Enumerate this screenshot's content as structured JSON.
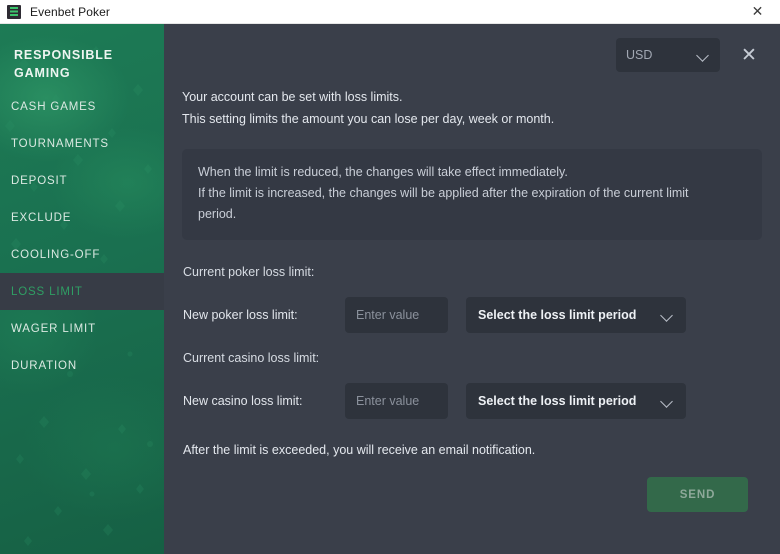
{
  "window": {
    "title": "Evenbet Poker",
    "app_icon": "evenbet-logo-icon",
    "close_label": "✕"
  },
  "sidebar": {
    "header": "RESPONSIBLE GAMING",
    "items": [
      {
        "label": "CASH GAMES",
        "active": false
      },
      {
        "label": "TOURNAMENTS",
        "active": false
      },
      {
        "label": "DEPOSIT",
        "active": false
      },
      {
        "label": "EXCLUDE",
        "active": false
      },
      {
        "label": "COOLING-OFF",
        "active": false
      },
      {
        "label": "LOSS LIMIT",
        "active": true
      },
      {
        "label": "WAGER LIMIT",
        "active": false
      },
      {
        "label": "DURATION",
        "active": false
      }
    ]
  },
  "panel": {
    "currency": {
      "value": "USD",
      "chevron": "chevron-down-icon"
    },
    "close_label": "✕"
  },
  "intro": {
    "line1": "Your account can be set with loss limits.",
    "line2": "This setting limits the amount you can lose per day, week or month."
  },
  "info_box": {
    "line1": "When the limit is reduced, the changes will take effect immediately.",
    "line2": "If the limit is increased, the changes will be applied after the expiration of the current limit",
    "line3": "period."
  },
  "form": {
    "poker": {
      "current_label": "Current poker loss limit:",
      "current_value": "",
      "new_label": "New poker loss limit:",
      "input_placeholder": "Enter value",
      "input_value": "",
      "period_value": "Select the loss limit period"
    },
    "casino": {
      "current_label": "Current casino loss limit:",
      "current_value": "",
      "new_label": "New casino loss limit:",
      "input_placeholder": "Enter value",
      "input_value": "",
      "period_value": "Select the loss limit period"
    }
  },
  "footer_note": "After the limit is exceeded, you will receive an email notification.",
  "send_button": {
    "label": "SEND"
  },
  "colors": {
    "panel_bg": "#3a3f4a",
    "field_bg": "#2e333c",
    "info_bg": "#343944",
    "sidebar_green": "#1a7050",
    "active_item_bg": "#373c46",
    "active_item_text": "#2f9e64",
    "send_bg": "#33694a",
    "send_text": "#8ea99a"
  }
}
